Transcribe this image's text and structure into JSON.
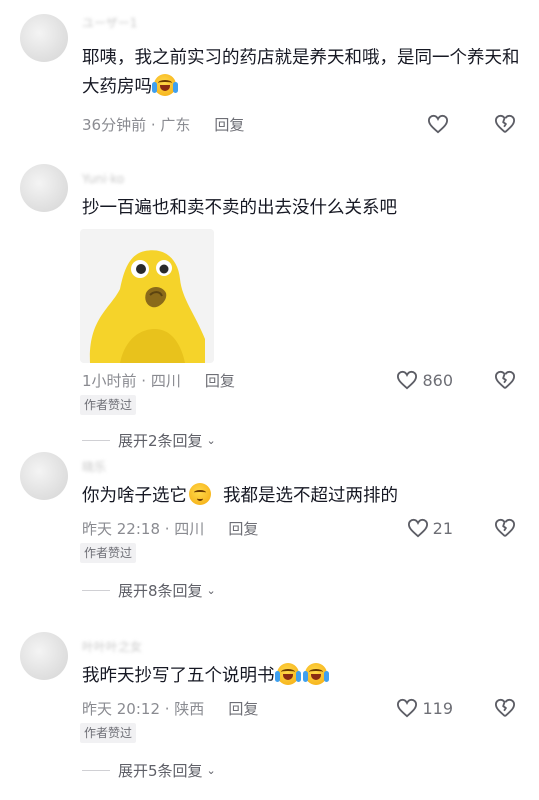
{
  "comments": [
    {
      "username": "ユーザー1",
      "text": "耶咦，我之前实习的药店就是养天和哦，是同一个养天和大药房吗",
      "time_location": "36分钟前 · 广东",
      "reply_label": "回复",
      "likes": ""
    },
    {
      "username": "Yuni·ko",
      "text": "抄一百遍也和卖不卖的出去没什么关系吧",
      "time_location": "1小时前 · 四川",
      "reply_label": "回复",
      "likes": "860",
      "badge": "作者赞过",
      "expand": "展开2条回复"
    },
    {
      "username": "晓乐",
      "text_a": "你为啥子选它",
      "text_b": "我都是选不超过两排的",
      "time_location": "昨天 22:18 · 四川",
      "reply_label": "回复",
      "likes": "21",
      "badge": "作者赞过",
      "expand": "展开8条回复"
    },
    {
      "username": "叶叶叶之女",
      "text": "我昨天抄写了五个说明书",
      "time_location": "昨天 20:12 · 陕西",
      "reply_label": "回复",
      "likes": "119",
      "badge": "作者赞过",
      "expand": "展开5条回复"
    }
  ],
  "icons": {
    "like": "heart-outline-icon",
    "dislike": "broken-heart-icon",
    "emoji_cry": "laughing-crying-emoji",
    "emoji_shy": "shy-emoji",
    "chevron": "chevron-down-icon"
  },
  "colors": {
    "text": "#161823",
    "meta": "#8a8b91",
    "badge_bg": "#f1f1f3",
    "sticker_yellow": "#f5d32a"
  }
}
